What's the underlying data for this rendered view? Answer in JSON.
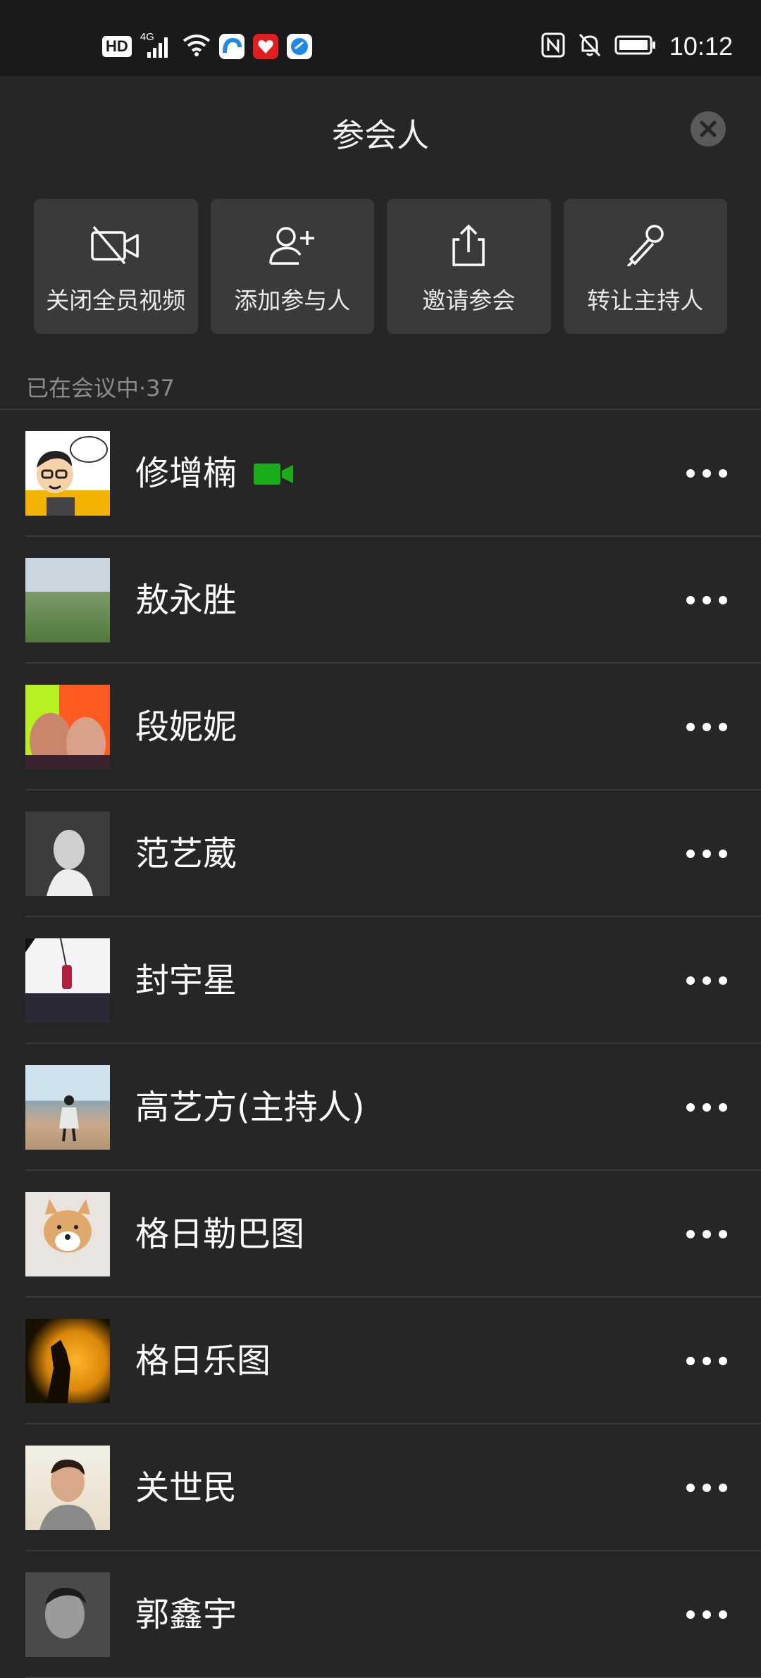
{
  "status_bar": {
    "network_badge": "HD",
    "network_type": "4G",
    "time": "10:12",
    "icons": [
      "hd-icon",
      "signal-icon",
      "wifi-icon",
      "app-icon-blue",
      "app-icon-red",
      "app-icon-globe",
      "nfc-icon",
      "mute-icon",
      "battery-icon"
    ]
  },
  "header": {
    "title": "参会人",
    "close_icon": "close-icon"
  },
  "actions": [
    {
      "label": "关闭全员视频",
      "icon": "camera-off-icon"
    },
    {
      "label": "添加参与人",
      "icon": "add-user-icon"
    },
    {
      "label": "邀请参会",
      "icon": "share-icon"
    },
    {
      "label": "转让主持人",
      "icon": "microphone-icon"
    }
  ],
  "section": {
    "label": "已在会议中·37"
  },
  "participants": [
    {
      "name": "修增楠",
      "video_on": true
    },
    {
      "name": "敖永胜"
    },
    {
      "name": "段妮妮"
    },
    {
      "name": "范艺葳"
    },
    {
      "name": "封宇星"
    },
    {
      "name": "高艺方(主持人)"
    },
    {
      "name": "格日勒巴图"
    },
    {
      "name": "格日乐图"
    },
    {
      "name": "关世民"
    },
    {
      "name": "郭鑫宇"
    }
  ],
  "colors": {
    "background": "#262626",
    "status_bar": "#1a1a1a",
    "action_tile": "#3a3a3a",
    "video_on": "#1aad19",
    "section_text": "#8c8c8c"
  }
}
